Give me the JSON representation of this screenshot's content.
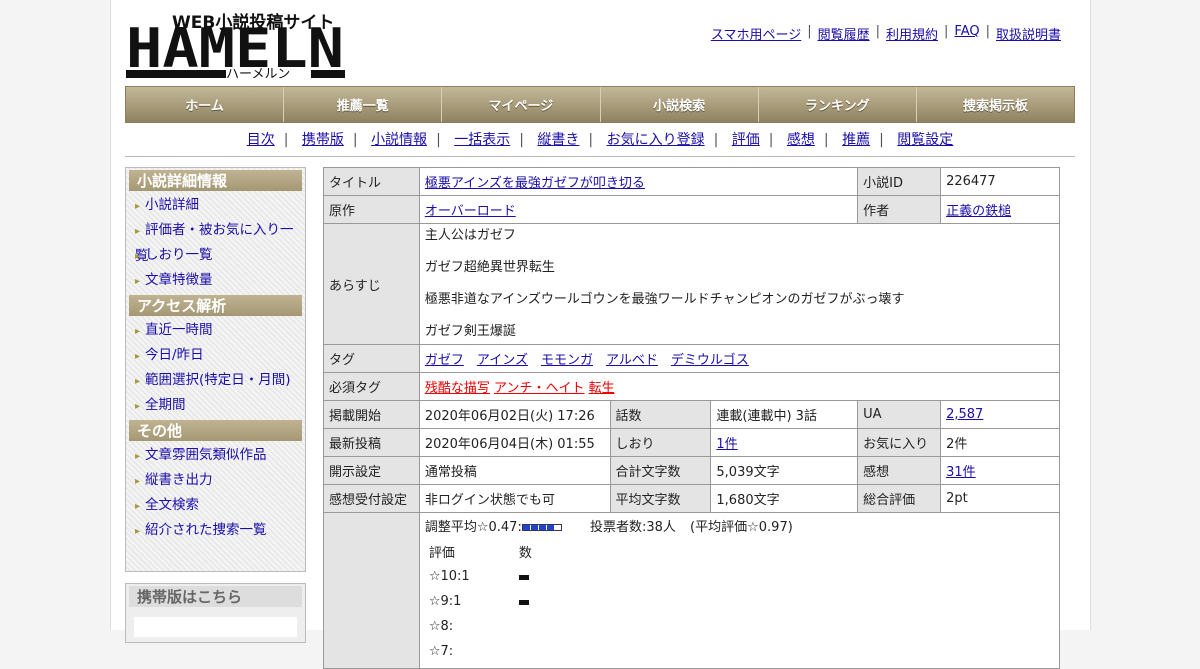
{
  "header": {
    "logo_main": "HAMELN",
    "logo_sub": "WEB小説投稿サイト",
    "logo_kana": "ハーメルン",
    "links": [
      "スマホ用ページ",
      "閲覧履歴",
      "利用規約",
      "FAQ",
      "取扱説明書"
    ]
  },
  "nav": [
    "ホーム",
    "推薦一覧",
    "マイページ",
    "小説検索",
    "ランキング",
    "捜索掲示板"
  ],
  "subnav": [
    "目次",
    "携帯版",
    "小説情報",
    "一括表示",
    "縦書き",
    "お気に入り登録",
    "評価",
    "感想",
    "推薦",
    "閲覧設定"
  ],
  "sidebar": {
    "sections": [
      {
        "title": "小説詳細情報",
        "items": [
          "小説詳細",
          "評価者・被お気に入り一覧",
          "しおり一覧",
          "文章特徴量"
        ]
      },
      {
        "title": "アクセス解析",
        "items": [
          "直近一時間",
          "今日/昨日",
          "範囲選択(特定日・月間)",
          "全期間"
        ]
      },
      {
        "title": "その他",
        "items": [
          "文章雰囲気類似作品",
          "縦書き出力",
          "全文検索",
          "紹介された捜索一覧"
        ]
      }
    ],
    "mobile_title": "携帯版はこちら"
  },
  "info": {
    "title_label": "タイトル",
    "title": "極悪アインズを最強ガゼフが叩き切る",
    "id_label": "小説ID",
    "id": "226477",
    "orig_label": "原作",
    "orig": "オーバーロード",
    "author_label": "作者",
    "author": "正義の鉄槌",
    "synopsis_label": "あらすじ",
    "synopsis": [
      "主人公はガゼフ",
      "ガゼフ超絶異世界転生",
      "極悪非道なアインズウールゴウンを最強ワールドチャンピオンのガゼフがぶっ壊す",
      "ガゼフ剣王爆誕"
    ],
    "tag_label": "タグ",
    "tags": [
      "ガゼフ",
      "アインズ",
      "モモンガ",
      "アルベド",
      "デミウルゴス"
    ],
    "req_tag_label": "必須タグ",
    "req_tags": [
      "残酷な描写",
      "アンチ・ヘイト",
      "転生"
    ],
    "rows": [
      [
        [
          "掲載開始",
          "2020年06月02日(火) 17:26"
        ],
        [
          "話数",
          "連載(連載中) 3話"
        ],
        [
          "UA",
          "2,587"
        ]
      ],
      [
        [
          "最新投稿",
          "2020年06月04日(木) 01:55"
        ],
        [
          "しおり",
          "1件"
        ],
        [
          "お気に入り",
          "2件"
        ]
      ],
      [
        [
          "開示設定",
          "通常投稿"
        ],
        [
          "合計文字数",
          "5,039文字"
        ],
        [
          "感想",
          "31件"
        ]
      ],
      [
        [
          "感想受付設定",
          "非ログイン状態でも可"
        ],
        [
          "平均文字数",
          "1,680文字"
        ],
        [
          "総合評価",
          "2pt"
        ]
      ]
    ],
    "rating": {
      "avg_text": "調整平均☆0.47:",
      "bar_fill": 0.85,
      "votes_text": "投票者数:38人",
      "plain_avg_text": "(平均評価☆0.97)",
      "col_rating": "評価",
      "col_count": "数",
      "dist": [
        "☆10:1",
        "☆9:1",
        "☆8:",
        "☆7:"
      ]
    }
  }
}
